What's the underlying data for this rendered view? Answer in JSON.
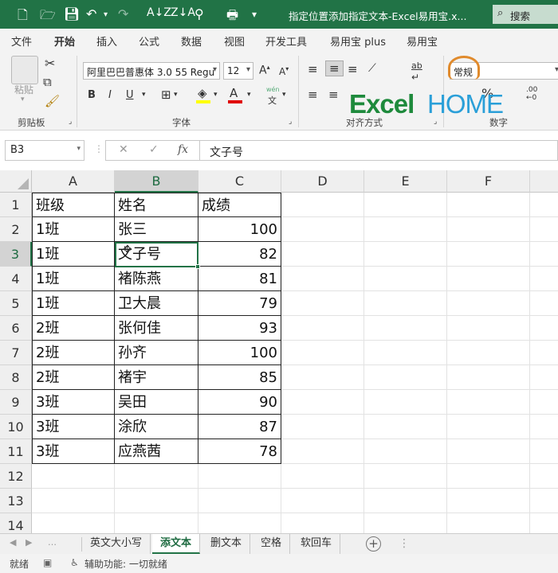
{
  "titlebar": {
    "title": "指定位置添加指定文本-Excel易用宝.x...",
    "search_label": "搜索",
    "bg_color": "#217346"
  },
  "ribbon_tabs": [
    "文件",
    "开始",
    "插入",
    "公式",
    "数据",
    "视图",
    "开发工具",
    "易用宝 plus",
    "易用宝"
  ],
  "active_tab": "开始",
  "ribbon": {
    "paste_label": "粘贴",
    "clipboard_label": "剪贴板",
    "font_name": "阿里巴巴普惠体 3.0 55 Regu",
    "font_size": "12",
    "font_group_label": "字体",
    "align_group_label": "对齐方式",
    "number_format": "常规",
    "number_group_label": "数字",
    "bold": "B",
    "italic": "I",
    "underline": "U",
    "pinyin_top": "wén",
    "pinyin_bottom": "文",
    "wrap_label": "ab",
    "percent": "%"
  },
  "logo": {
    "part1": "Excel",
    "part2": "HOME"
  },
  "formula_bar": {
    "name_box": "B3",
    "formula": "文子号",
    "fx": "fx"
  },
  "columns": [
    "A",
    "B",
    "C",
    "D",
    "E",
    "F"
  ],
  "selected_column": "B",
  "rows": [
    "1",
    "2",
    "3",
    "4",
    "5",
    "6",
    "7",
    "8",
    "9",
    "10",
    "11",
    "12",
    "13",
    "14"
  ],
  "selected_row": "3",
  "table": {
    "headers": [
      "班级",
      "姓名",
      "成绩"
    ],
    "data": [
      [
        "1班",
        "张三",
        "100"
      ],
      [
        "1班",
        "文子号",
        "82"
      ],
      [
        "1班",
        "褚陈燕",
        "81"
      ],
      [
        "1班",
        "卫大晨",
        "79"
      ],
      [
        "2班",
        "张何佳",
        "93"
      ],
      [
        "2班",
        "孙齐",
        "100"
      ],
      [
        "2班",
        "褚宇",
        "85"
      ],
      [
        "3班",
        "吴田",
        "90"
      ],
      [
        "3班",
        "涂欣",
        "87"
      ],
      [
        "3班",
        "应燕茜",
        "78"
      ]
    ]
  },
  "sheets": [
    "英文大小写",
    "添文本",
    "删文本",
    "空格",
    "软回车"
  ],
  "active_sheet": "添文本",
  "status": {
    "ready": "就绪",
    "accessibility": "辅助功能: 一切就绪"
  }
}
